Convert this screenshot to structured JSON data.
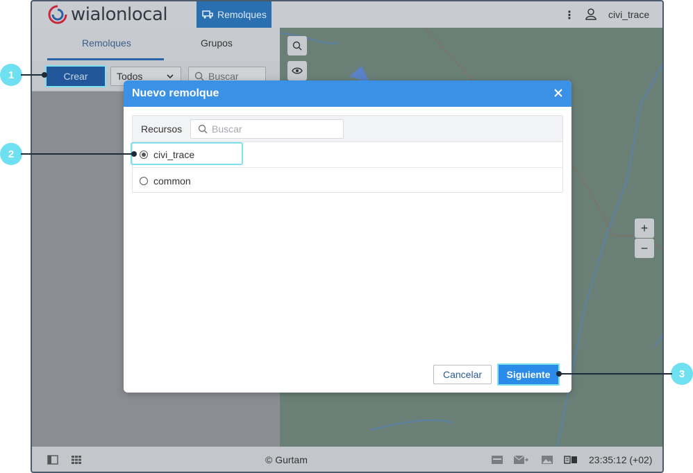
{
  "app": {
    "logo_text": "wialonlocal",
    "nav_tab_label": "Remolques",
    "user_name": "civi_trace"
  },
  "left_panel": {
    "tabs": [
      {
        "label": "Remolques",
        "active": true
      },
      {
        "label": "Grupos",
        "active": false
      }
    ],
    "create_label": "Crear",
    "filter_selected": "Todos",
    "search_placeholder": "Buscar"
  },
  "dialog": {
    "title": "Nuevo remolque",
    "resources_label": "Recursos",
    "search_placeholder": "Buscar",
    "resources": [
      {
        "label": "civi_trace",
        "selected": true
      },
      {
        "label": "common",
        "selected": false
      }
    ],
    "cancel_label": "Cancelar",
    "next_label": "Siguiente"
  },
  "map": {
    "zoom_in": "+",
    "zoom_out": "−"
  },
  "bottom_bar": {
    "copyright": "© Gurtam",
    "time": "23:35:12 (+02)"
  },
  "callouts": [
    "1",
    "2",
    "3"
  ],
  "colors": {
    "accent": "#3b91e6",
    "primary_button": "#2b8be8",
    "highlight": "#7fe0ee",
    "callout": "#6ee0ef"
  },
  "icons": {
    "nav_tab": "trailer-icon",
    "menu": "more-vertical-icon",
    "user": "user-icon",
    "search": "search-icon",
    "close": "close-icon",
    "eye": "eye-icon"
  }
}
